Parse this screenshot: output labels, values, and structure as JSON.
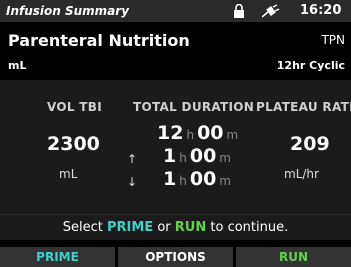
{
  "status": {
    "title": "Infusion Summary",
    "time": "16:20",
    "icons": [
      "lock-icon",
      "plug-icon"
    ]
  },
  "header": {
    "therapy": "Parenteral Nutrition",
    "units": "mL",
    "drug_code": "TPN",
    "mode": "12hr Cyclic"
  },
  "summary": {
    "vol_tbi": {
      "label": "VOL TBI",
      "value": "2300",
      "unit": "mL"
    },
    "duration": {
      "label": "TOTAL DURATION",
      "total": {
        "h": "12",
        "m": "00"
      },
      "ramp_up": {
        "h": "1",
        "m": "00"
      },
      "ramp_down": {
        "h": "1",
        "m": "00"
      },
      "h_label": "h",
      "m_label": "m"
    },
    "plateau": {
      "label": "PLATEAU RATE",
      "value": "209",
      "unit": "mL/hr"
    }
  },
  "prompt": {
    "pre": "Select ",
    "prime": "PRIME",
    "mid": " or ",
    "run": "RUN",
    "post": " to continue."
  },
  "softkeys": {
    "left": "PRIME",
    "center": "OPTIONS",
    "right": "RUN"
  },
  "colors": {
    "prime": "#3fd0c8",
    "run": "#5fd34a",
    "status_bar": "#2a2a2a",
    "panel": "#1b1b1b"
  }
}
